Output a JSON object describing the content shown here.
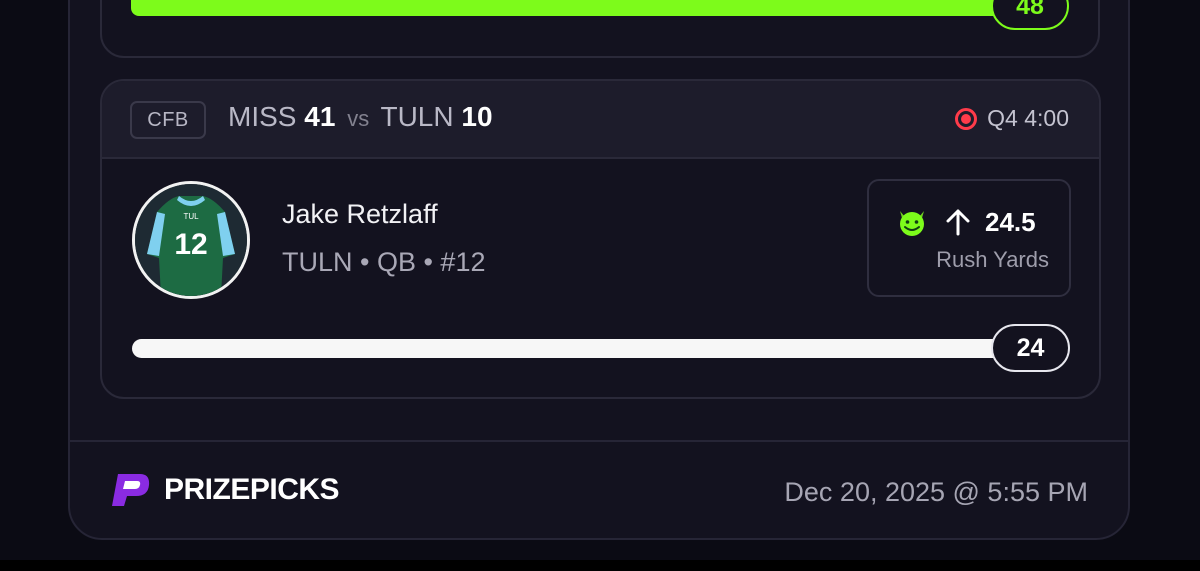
{
  "previous_card": {
    "progress_value": "48",
    "progress_fraction": 1.0,
    "accent_color": "#7dfb1b"
  },
  "card": {
    "league": "CFB",
    "matchup": {
      "away_team": "MISS",
      "away_score": "41",
      "vs_label": "vs",
      "home_team": "TULN",
      "home_score": "10"
    },
    "status": {
      "icon": "live-indicator-icon",
      "text": "Q4 4:00",
      "color": "#ff3b4a"
    },
    "player": {
      "name": "Jake Retzlaff",
      "meta": "TULN • QB • #12",
      "avatar_icon": "player-jersey-icon"
    },
    "projection": {
      "pick_icon": "demon-icon",
      "direction_icon": "arrow-up-icon",
      "line": "24.5",
      "stat": "Rush Yards"
    },
    "progress": {
      "value": "24",
      "fraction": 0.98
    }
  },
  "footer": {
    "brand": "PRIZEPICKS",
    "brand_color": "#8a2be2",
    "timestamp": "Dec 20, 2025 @ 5:55 PM"
  }
}
